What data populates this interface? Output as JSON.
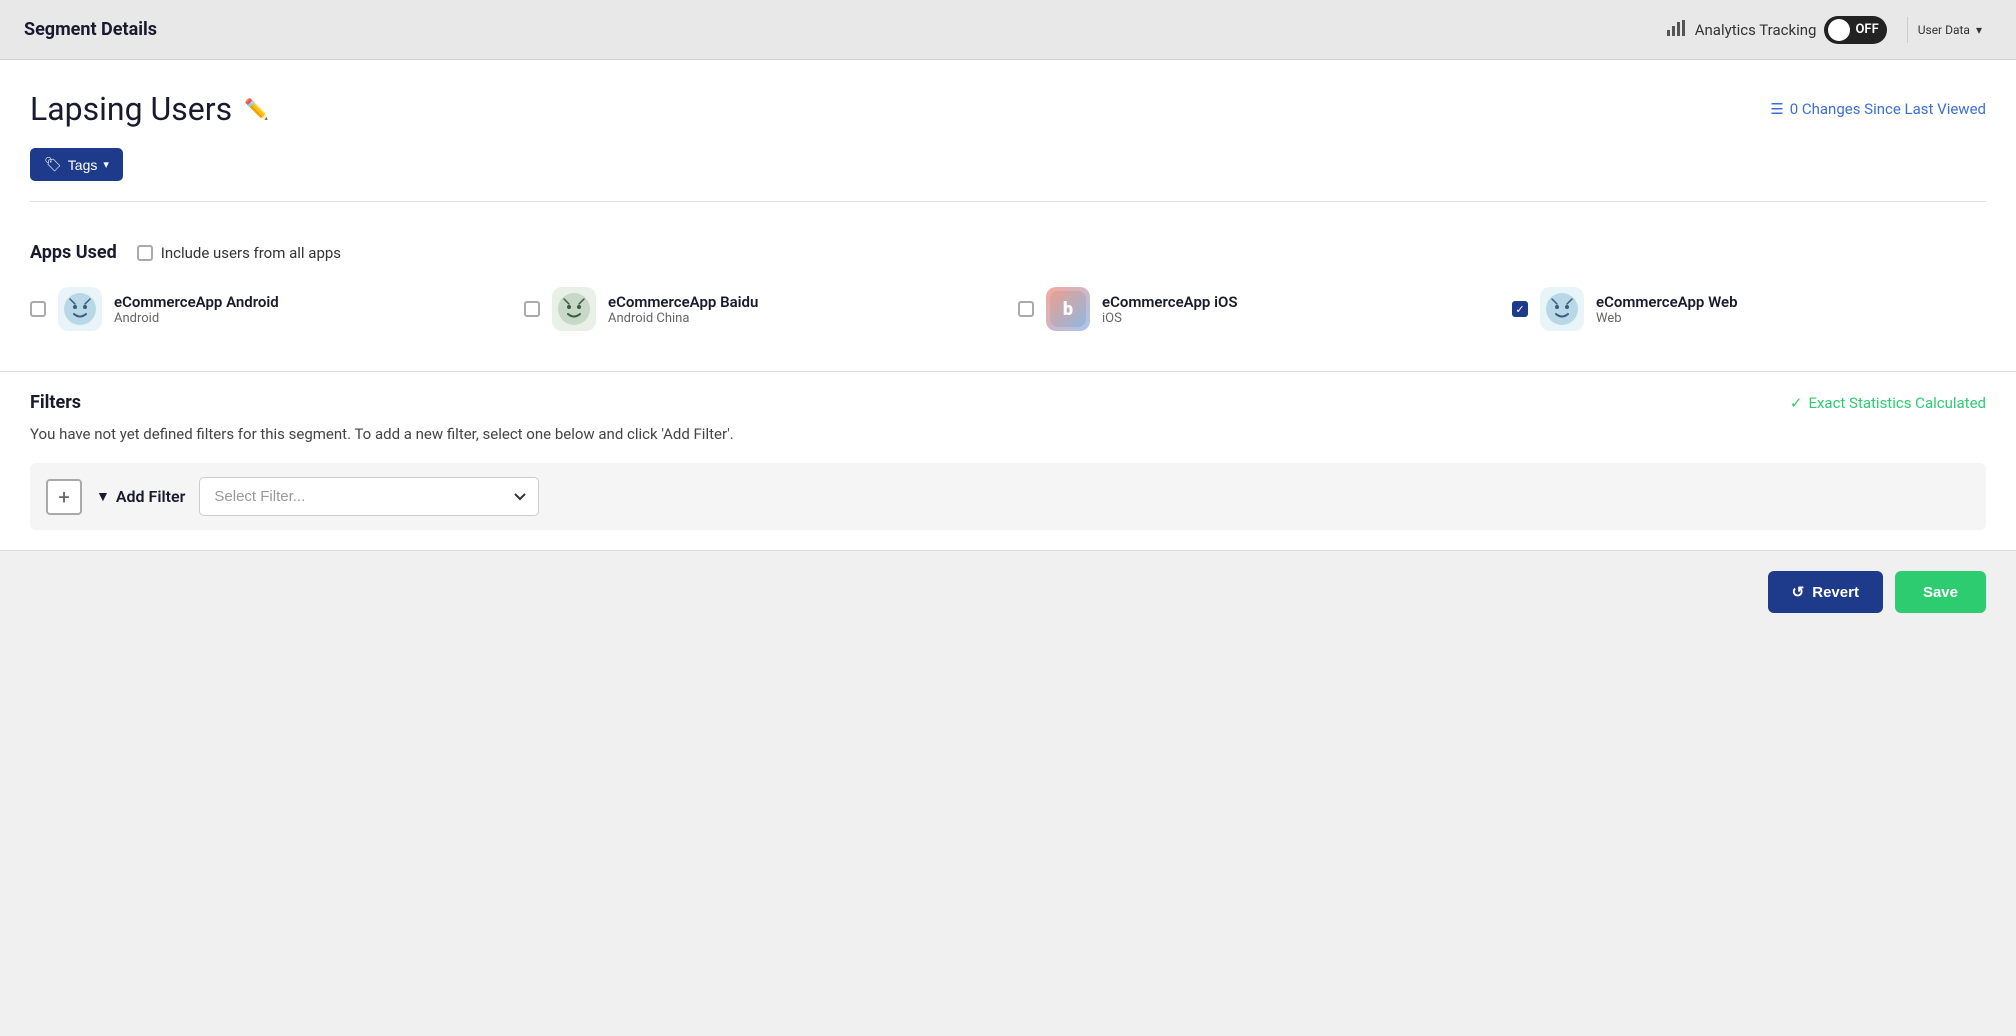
{
  "header": {
    "title": "Segment Details",
    "analytics_tracking_label": "Analytics Tracking",
    "toggle_state": "OFF",
    "user_data_label": "User Data"
  },
  "page": {
    "title": "Lapsing Users",
    "changes_label": "0 Changes Since Last Viewed",
    "tags_label": "Tags"
  },
  "apps_used": {
    "section_title": "Apps Used",
    "include_all_label": "Include users from all apps",
    "apps": [
      {
        "name": "eCommerceApp Android",
        "platform": "Android",
        "icon_type": "smiley",
        "checked": false
      },
      {
        "name": "eCommerceApp Baidu",
        "platform": "Android China",
        "icon_type": "baidu",
        "checked": false
      },
      {
        "name": "eCommerceApp iOS",
        "platform": "iOS",
        "icon_type": "ios",
        "checked": false
      },
      {
        "name": "eCommerceApp Web",
        "platform": "Web",
        "icon_type": "smiley",
        "checked": true
      }
    ]
  },
  "filters": {
    "section_title": "Filters",
    "exact_stats_label": "Exact Statistics Calculated",
    "description": "You have not yet defined filters for this segment. To add a new filter, select one below and click 'Add Filter'.",
    "add_filter_label": "Add Filter",
    "select_placeholder": "Select Filter..."
  },
  "footer": {
    "revert_label": "Revert",
    "save_label": "Save"
  }
}
